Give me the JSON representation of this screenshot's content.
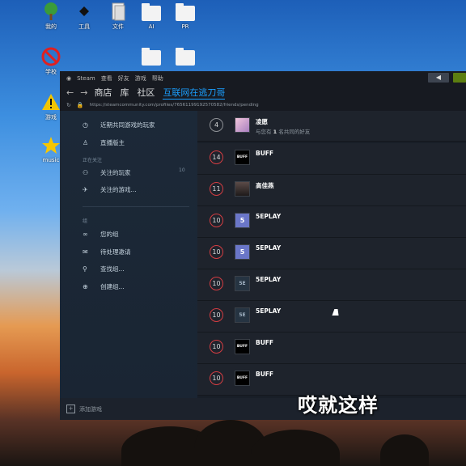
{
  "desktop": {
    "icons": [
      {
        "name": "tree-icon",
        "label": "我的"
      },
      {
        "name": "diamond-icon",
        "label": "工具"
      },
      {
        "name": "document-icon",
        "label": "文件"
      },
      {
        "name": "folder-icon",
        "label": "AI"
      },
      {
        "name": "folder-icon",
        "label": "PR"
      },
      {
        "name": "forbidden-icon",
        "label": "学校"
      },
      {
        "name": "warning-icon",
        "label": "游戏"
      },
      {
        "name": "star-icon",
        "label": "music"
      }
    ]
  },
  "steam": {
    "menu": [
      "Steam",
      "查看",
      "好友",
      "游戏",
      "帮助"
    ],
    "nav": {
      "back": "←",
      "forward": "→",
      "store": "商店",
      "library": "库",
      "community": "社区",
      "user": "互联网在逃刀哥"
    },
    "url": "https://steamcommunity.com/profiles/76561199192570582/friends/pending",
    "sidebar": {
      "items_top": [
        {
          "icon": "clock-icon",
          "label": "近期共同游戏的玩家"
        },
        {
          "icon": "broadcaster-icon",
          "label": "直播版主"
        }
      ],
      "following_header": "正在关注",
      "following": [
        {
          "icon": "users-icon",
          "label": "关注的玩家",
          "count": "10"
        },
        {
          "icon": "controller-icon",
          "label": "关注的游戏..."
        }
      ],
      "groups_header": "组",
      "groups": [
        {
          "icon": "group-icon",
          "label": "您的组"
        },
        {
          "icon": "mail-icon",
          "label": "待处理邀请"
        },
        {
          "icon": "search-icon",
          "label": "查找组..."
        },
        {
          "icon": "plus-circle-icon",
          "label": "创建组..."
        }
      ]
    },
    "requests": [
      {
        "level": "4",
        "name": "凌愿",
        "sub_prefix": "与您有",
        "sub_count": "1",
        "sub_suffix": "名共同的好友",
        "avatar": "pink"
      },
      {
        "level": "14",
        "name": "BUFF",
        "avatar": "buff"
      },
      {
        "level": "11",
        "name": "高佳燕",
        "avatar": "photo"
      },
      {
        "level": "10",
        "name": "5EPLAY",
        "avatar": "5e"
      },
      {
        "level": "10",
        "name": "5EPLAY",
        "avatar": "5e"
      },
      {
        "level": "10",
        "name": "5EPLAY",
        "avatar": "5e-dark"
      },
      {
        "level": "10",
        "name": "5EPLAY",
        "avatar": "5e-dark"
      },
      {
        "level": "10",
        "name": "BUFF",
        "avatar": "buff"
      },
      {
        "level": "10",
        "name": "BUFF",
        "avatar": "buff"
      }
    ],
    "add_game": "添加游戏"
  },
  "subtitle": "哎就这样",
  "colors": {
    "accent": "#1a9fff",
    "level_ring": "#d33d42",
    "steam_bg": "#171d25"
  }
}
